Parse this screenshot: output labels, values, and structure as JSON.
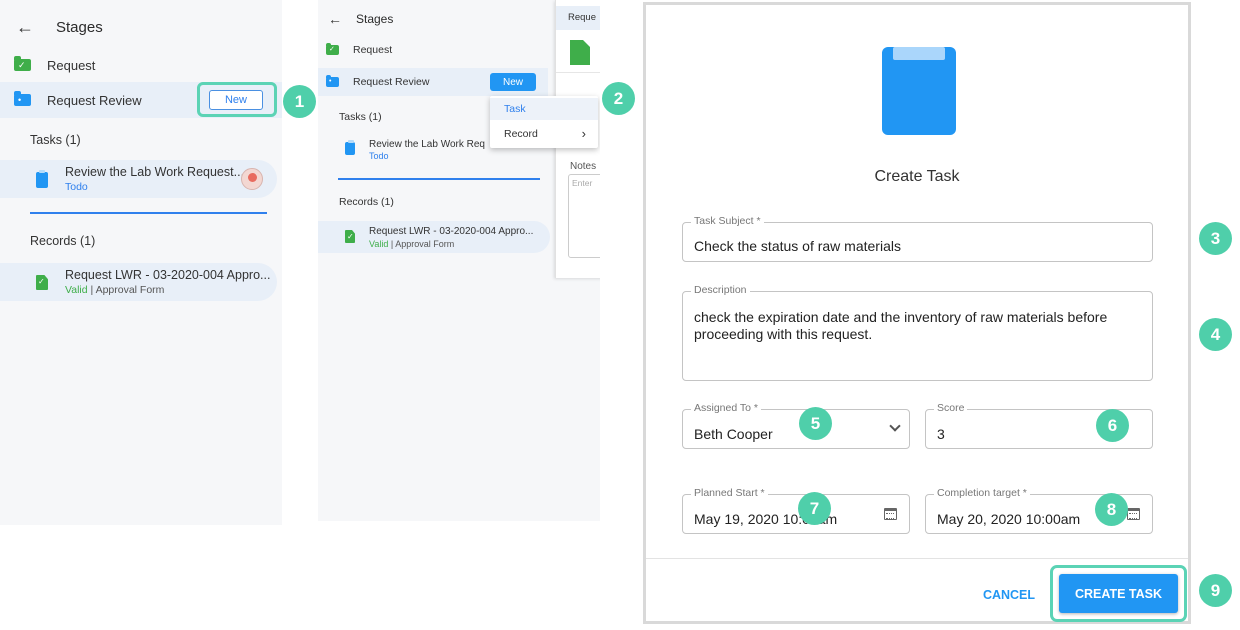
{
  "panel1": {
    "header": "Stages",
    "stages": [
      {
        "label": "Request"
      },
      {
        "label": "Request Review"
      }
    ],
    "new_button": "New",
    "tasks_heading": "Tasks (1)",
    "task": {
      "title": "Review the Lab Work Request...",
      "status": "Todo"
    },
    "records_heading": "Records (1)",
    "record": {
      "title": "Request LWR - 03-2020-004 Appro...",
      "status": "Valid",
      "type": "| Approval Form"
    }
  },
  "panel2": {
    "header": "Stages",
    "stages": [
      {
        "label": "Request"
      },
      {
        "label": "Request Review"
      }
    ],
    "new_button": "New",
    "tasks_heading": "Tasks (1)",
    "task": {
      "title": "Review the Lab Work Req",
      "status": "Todo"
    },
    "records_heading": "Records (1)",
    "record": {
      "title": "Request LWR - 03-2020-004 Appro...",
      "status": "Valid",
      "type": "| Approval Form"
    },
    "menu": {
      "task": "Task",
      "record": "Record"
    },
    "right_tab": "Reque",
    "notes_label": "Notes",
    "notes_placeholder": "Enter"
  },
  "dialog": {
    "title": "Create Task",
    "fields": {
      "subject": {
        "label": "Task Subject *",
        "value": "Check the status of raw materials"
      },
      "description": {
        "label": "Description",
        "value": "check the expiration date and the inventory of raw materials before proceeding with this request."
      },
      "assigned_to": {
        "label": "Assigned To *",
        "value": "Beth Cooper"
      },
      "score": {
        "label": "Score",
        "value": "3"
      },
      "planned_start": {
        "label": "Planned Start *",
        "value": "May 19, 2020 10:00am"
      },
      "completion_target": {
        "label": "Completion target *",
        "value": "May 20, 2020 10:00am"
      }
    },
    "cancel": "CANCEL",
    "create": "CREATE TASK"
  },
  "steps": [
    "1",
    "2",
    "3",
    "4",
    "5",
    "6",
    "7",
    "8",
    "9"
  ],
  "colors": {
    "accent": "#2196f3",
    "highlight": "#5bd3b5",
    "badge": "#4fcfaa",
    "valid": "#3fae4a"
  }
}
